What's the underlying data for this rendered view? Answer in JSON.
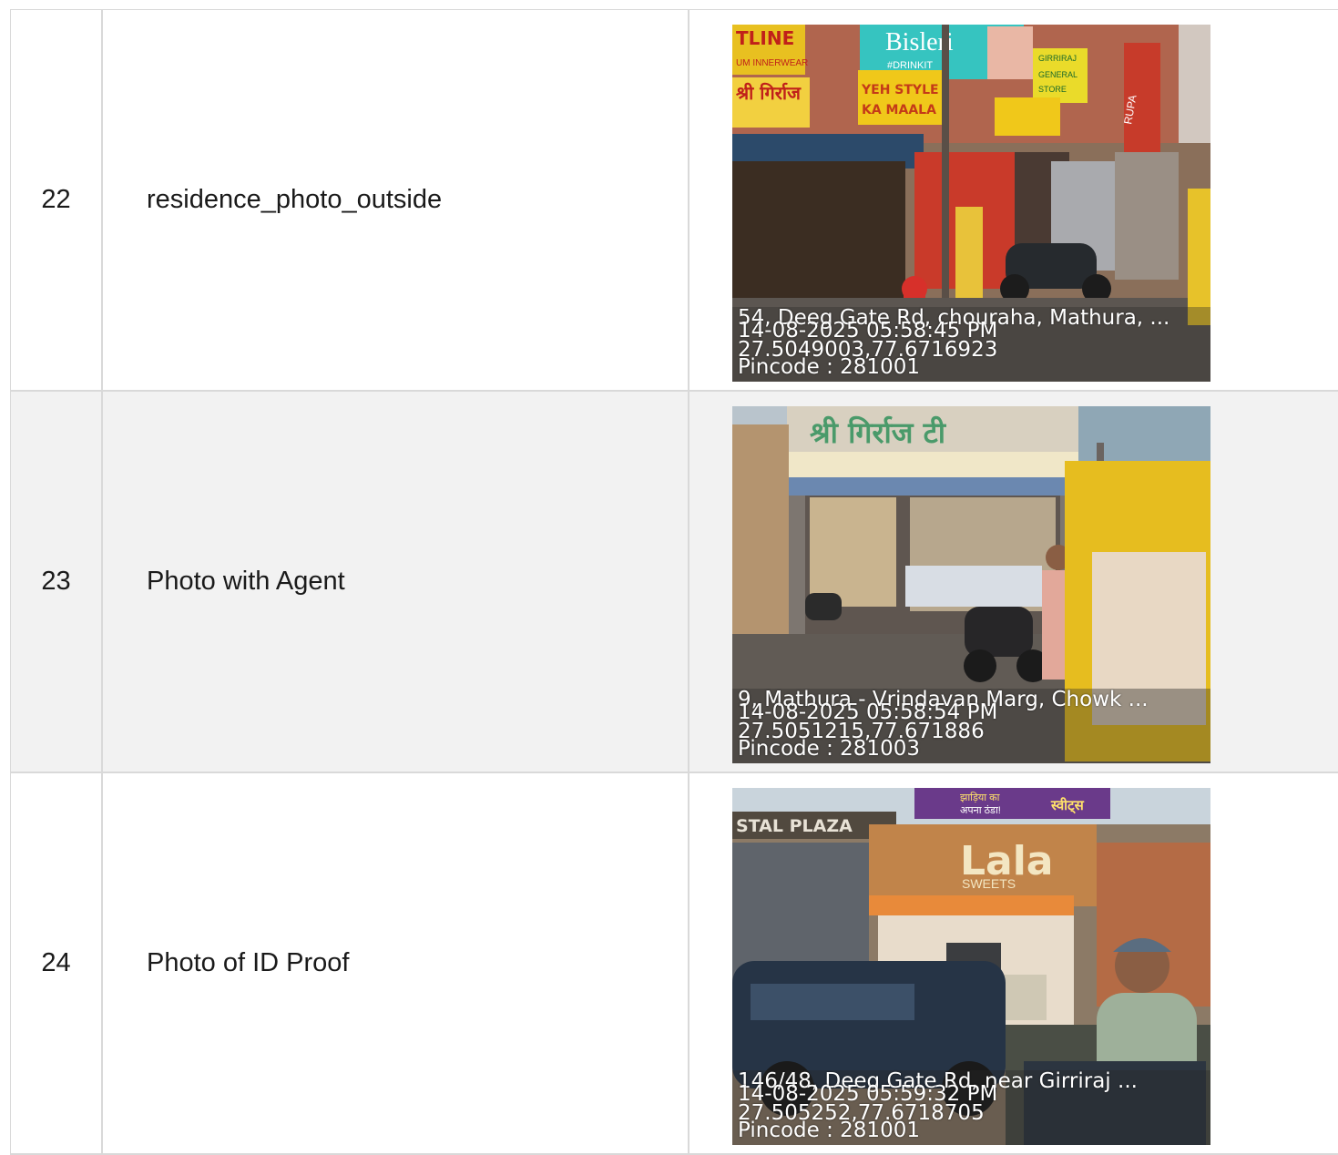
{
  "rows": [
    {
      "number": "22",
      "label": "residence_photo_outside",
      "photo": {
        "address": "54, Deeg Gate Rd, chouraha, Mathura, ...",
        "datetime": "14-08-2025 05:58:45 PM",
        "coords": "27.5049003,77.6716923",
        "pincode": "Pincode : 281001",
        "signs": [
          "Bisleri",
          "#DRINKIT",
          "GIRRIRAJ",
          "GENERAL",
          "STORE",
          "YEH STYLE",
          "KA MAALA",
          "श्री गिर्राज",
          "TLINE",
          "UM INNERWEAR",
          "RUPA"
        ]
      }
    },
    {
      "number": "23",
      "label": "Photo with Agent",
      "photo": {
        "address": "9, Mathura - Vrindavan Marg, Chowk ...",
        "datetime": "14-08-2025 05:58:54 PM",
        "coords": "27.5051215,77.671886",
        "pincode": "Pincode : 281003",
        "signs": [
          "श्री गिर्राज टी"
        ]
      }
    },
    {
      "number": "24",
      "label": "Photo of ID Proof",
      "photo": {
        "address": "146/48, Deeg Gate Rd, near Girriraj ...",
        "datetime": "14-08-2025 05:59:32 PM",
        "coords": "27.505252,77.6718705",
        "pincode": "Pincode : 281001",
        "signs": [
          "Lala",
          "SWEETS",
          "STAL PLAZA",
          "स्वीट्स",
          "अपना ठंडा!",
          "झाड़िया का"
        ]
      }
    }
  ]
}
